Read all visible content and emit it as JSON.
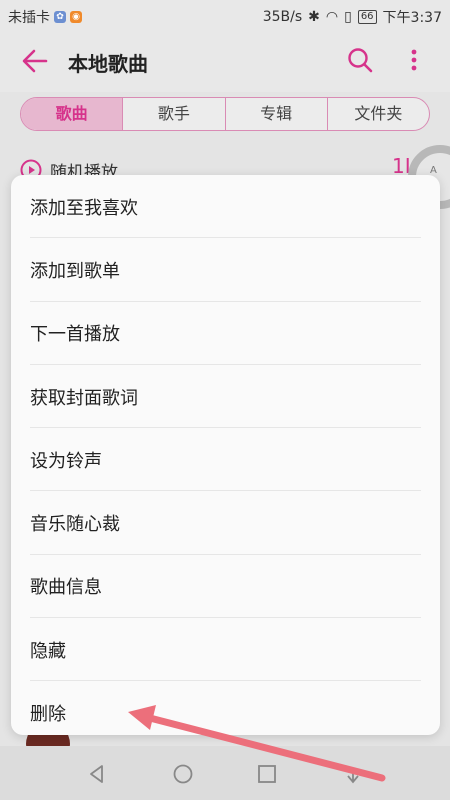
{
  "status_bar": {
    "carrier": "未插卡",
    "speed": "35B/s",
    "battery": "66",
    "time": "下午3:37"
  },
  "header": {
    "title": "本地歌曲",
    "back_icon": "arrow-left-icon",
    "search_icon": "search-icon",
    "more_icon": "more-vertical-icon"
  },
  "tabs": [
    "歌曲",
    "歌手",
    "专辑",
    "文件夹"
  ],
  "shuffle": {
    "label": "随机播放",
    "count_fragment": "1L"
  },
  "side_ring_letter": "A",
  "menu": {
    "items": [
      "添加至我喜欢",
      "添加到歌单",
      "下一首播放",
      "获取封面歌词",
      "设为铃声",
      "音乐随心裁",
      "歌曲信息",
      "隐藏",
      "删除"
    ]
  },
  "colors": {
    "accent": "#d6338b",
    "annotation_arrow": "#ec6f7b"
  }
}
